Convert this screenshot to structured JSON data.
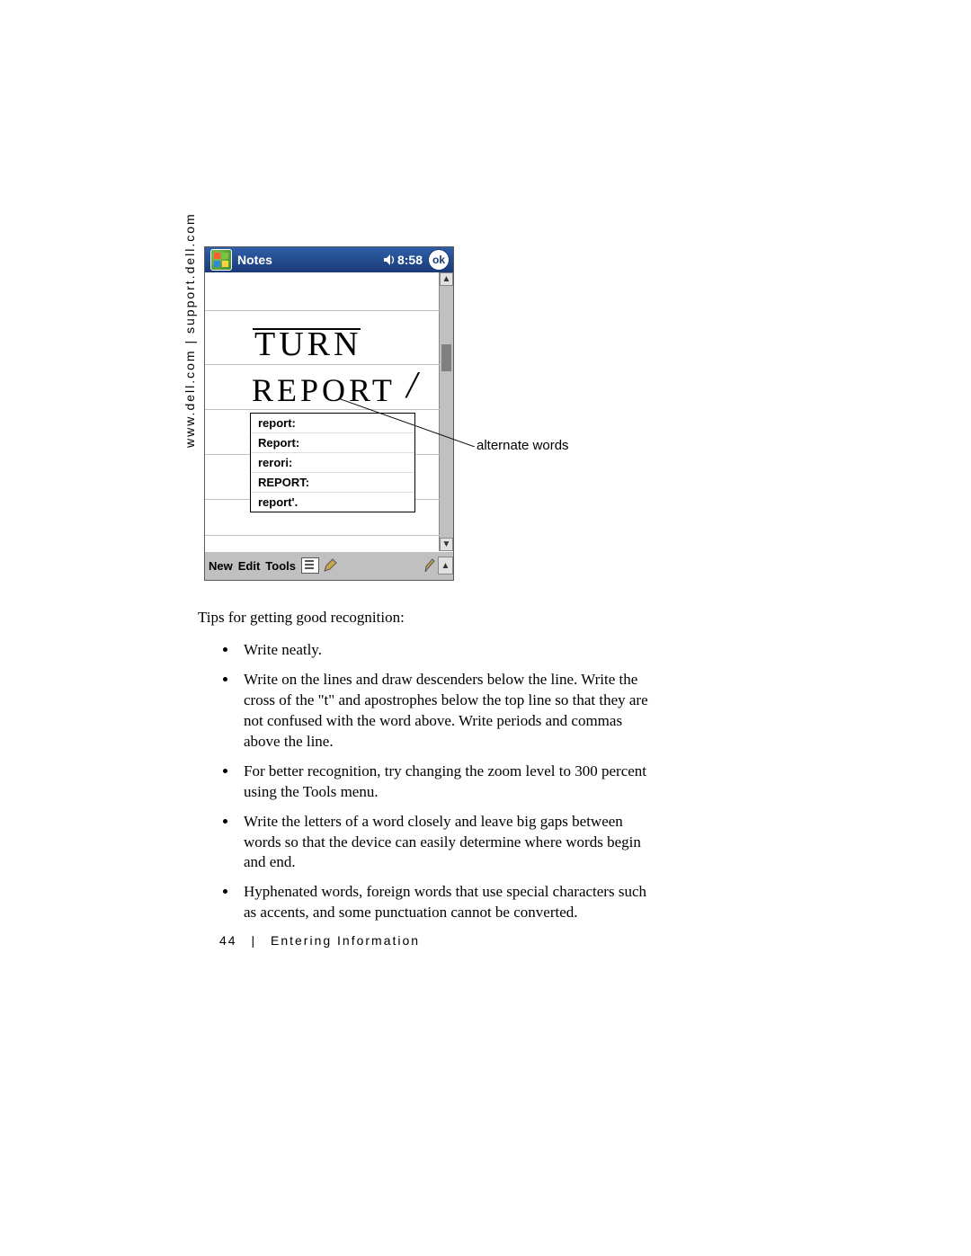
{
  "side_url": "www.dell.com | support.dell.com",
  "titlebar": {
    "app": "Notes",
    "time": "8:58",
    "ok": "ok"
  },
  "handwriting": {
    "line1": "TURN",
    "line2": "REPORT"
  },
  "popup": [
    "report:",
    "Report:",
    "rerori:",
    "REPORT:",
    "report'."
  ],
  "bottombar": {
    "new": "New",
    "edit": "Edit",
    "tools": "Tools"
  },
  "callout": "alternate words",
  "tips_intro": "Tips for getting good recognition:",
  "tips": [
    "Write neatly.",
    "Write on the lines and draw descenders below the line. Write the cross of the \"t\" and apostrophes below the top line so that they are not confused with the word above. Write periods and commas above the line.",
    "For better recognition, try changing the zoom level to 300 percent using the Tools menu.",
    "Write the letters of a word closely and leave big gaps between words so that the device can easily determine where words begin and end.",
    "Hyphenated words, foreign words that use special characters such as accents, and some punctuation cannot be converted."
  ],
  "footer": {
    "page": "44",
    "chapter": "Entering Information"
  }
}
